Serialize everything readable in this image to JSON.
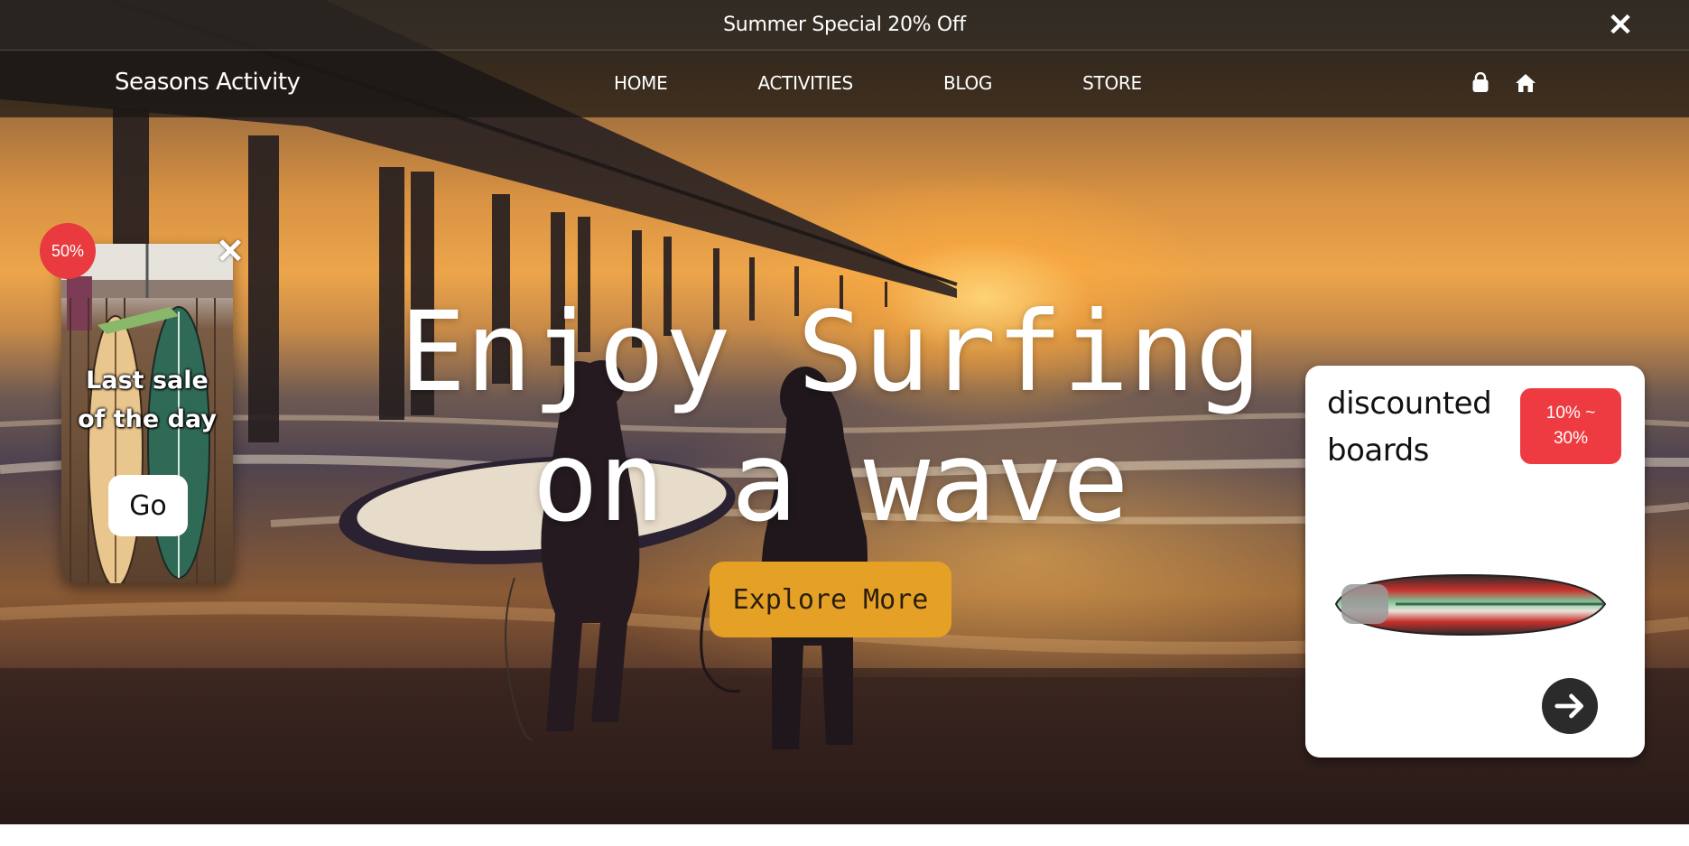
{
  "announcement": {
    "text": "Summer Special 20% Off",
    "close_icon": "close-icon"
  },
  "nav": {
    "brand": "Seasons Activity",
    "links": [
      "HOME",
      "ACTIVITIES",
      "BLOG",
      "STORE"
    ],
    "icons": [
      "shopping-bag-icon",
      "home-icon"
    ]
  },
  "hero": {
    "headline_line1": "Enjoy Surfing",
    "headline_line2": "on a wave",
    "cta_label": "Explore More",
    "cta_color": "#e5a126"
  },
  "promo": {
    "badge": "50%",
    "text_line1": "Last sale",
    "text_line2": "of the day",
    "button_label": "Go",
    "close_icon": "close-icon",
    "badge_color": "#e83a3f"
  },
  "board_card": {
    "title_line1": "discounted",
    "title_line2": "boards",
    "badge_line1": "10% ~",
    "badge_line2": "30%",
    "badge_color": "#ee3b41",
    "arrow_icon": "arrow-right-icon"
  }
}
